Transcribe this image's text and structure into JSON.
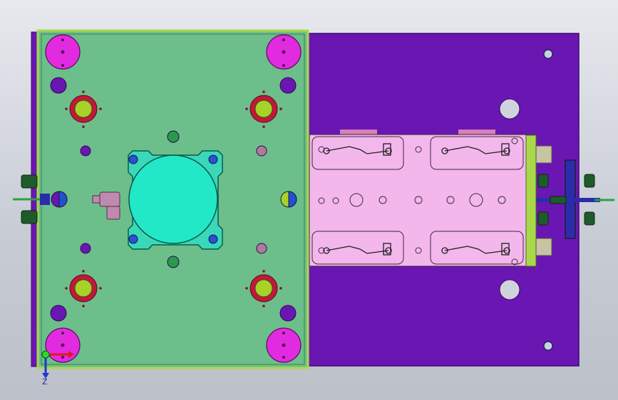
{
  "viewport": {
    "background_top": "#e7e9ee",
    "background_bottom": "#bcc0c9"
  },
  "colors": {
    "base_plate": "#6a16b2",
    "base_plate_edge": "#3a0a70",
    "mold_plate": "#6cbf8a",
    "mold_plate_edge": "#a9d94a",
    "insert_plate": "#f3b7ec",
    "guide_pillar": "#e22be0",
    "return_pin": "#a8d22a",
    "cavity": "#22e8c8",
    "hose": "#1f5a2c",
    "manifold": "#2b2da8",
    "axis_x": "#e01a1a",
    "axis_y": "#1b3ad0",
    "axis_origin": "#2adb2a"
  },
  "triad": {
    "y_label": "Z"
  },
  "icons": {
    "origin": "triad-origin-icon",
    "x_arrow": "x-axis-arrow-icon",
    "y_arrow": "y-axis-arrow-icon"
  }
}
